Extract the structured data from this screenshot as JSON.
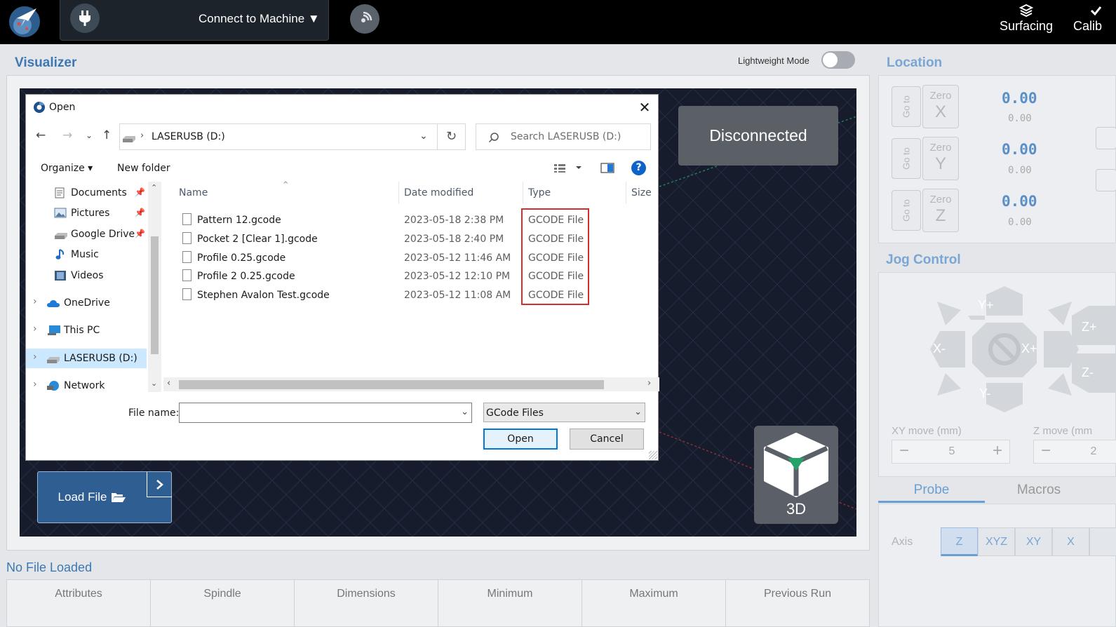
{
  "topbar": {
    "connect_label": "Connect to Machine ▼",
    "tools": [
      {
        "label": "Surfacing"
      },
      {
        "label": "Calib"
      }
    ]
  },
  "visualizer": {
    "title": "Visualizer",
    "lightweight_label": "Lightweight Mode",
    "lightweight_on": false,
    "status": "Disconnected",
    "view_label": "3D",
    "load_file_label": "Load File"
  },
  "file_info": {
    "no_file": "No File Loaded",
    "columns": [
      "Attributes",
      "Spindle",
      "Dimensions",
      "Minimum",
      "Maximum",
      "Previous Run"
    ]
  },
  "location": {
    "title": "Location",
    "goto_label": "Go to",
    "zero_label": "Zero",
    "axes": [
      {
        "axis": "X",
        "value": "0.00",
        "machine": "0.00"
      },
      {
        "axis": "Y",
        "value": "0.00",
        "machine": "0.00"
      },
      {
        "axis": "Z",
        "value": "0.00",
        "machine": "0.00"
      }
    ]
  },
  "jog": {
    "title": "Jog Control",
    "labels": {
      "yplus": "Y+",
      "yminus": "Y-",
      "xplus": "X+",
      "xminus": "X-",
      "zplus": "Z+",
      "zminus": "Z-"
    },
    "xy_label": "XY move (mm)",
    "z_label": "Z move (mm",
    "xy_value": "5",
    "z_value": "2",
    "minus": "−",
    "plus": "+"
  },
  "tabs": {
    "probe": "Probe",
    "macros": "Macros"
  },
  "probe": {
    "axis_label": "Axis",
    "options": [
      "Z",
      "XYZ",
      "XY",
      "X"
    ]
  },
  "dialog": {
    "title": "Open",
    "address": "LASERUSB (D:)",
    "search_placeholder": "Search LASERUSB (D:)",
    "organize": "Organize ▾",
    "new_folder": "New folder",
    "tree": [
      {
        "label": "Documents",
        "pinned": true
      },
      {
        "label": "Pictures",
        "pinned": true
      },
      {
        "label": "Google Drive",
        "pinned": true
      },
      {
        "label": "Music",
        "pinned": false
      },
      {
        "label": "Videos",
        "pinned": false
      },
      {
        "label": "OneDrive",
        "pinned": false
      },
      {
        "label": "This PC",
        "pinned": false
      },
      {
        "label": "LASERUSB (D:)",
        "pinned": false
      },
      {
        "label": "Network",
        "pinned": false
      }
    ],
    "columns": {
      "name": "Name",
      "date": "Date modified",
      "type": "Type",
      "size": "Size"
    },
    "files": [
      {
        "name": "Pattern 12.gcode",
        "date": "2023-05-18 2:38 PM",
        "type": "GCODE File"
      },
      {
        "name": "Pocket 2 [Clear 1].gcode",
        "date": "2023-05-18 2:40 PM",
        "type": "GCODE File"
      },
      {
        "name": "Profile 0.25.gcode",
        "date": "2023-05-12 11:46 AM",
        "type": "GCODE File"
      },
      {
        "name": "Profile 2  0.25.gcode",
        "date": "2023-05-12 12:10 PM",
        "type": "GCODE File"
      },
      {
        "name": "Stephen Avalon Test.gcode",
        "date": "2023-05-12 11:08 AM",
        "type": "GCODE File"
      }
    ],
    "filename_label": "File name:",
    "filename_value": "",
    "filetype": "GCode Files",
    "open_label": "Open",
    "cancel_label": "Cancel"
  }
}
